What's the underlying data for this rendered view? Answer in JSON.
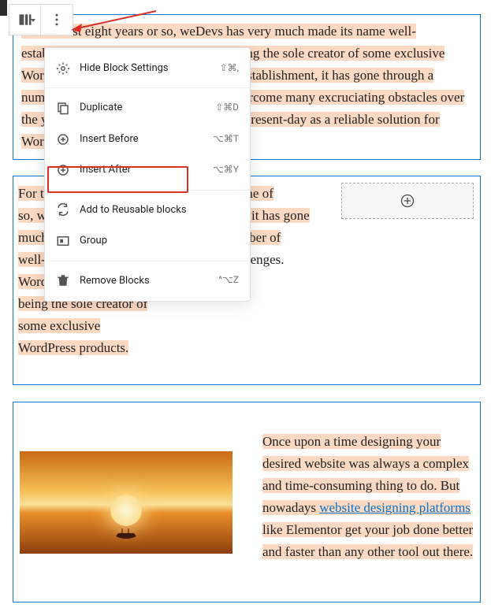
{
  "toolbar": {
    "layout_button": "change-layout",
    "more_button": "more-options"
  },
  "menu": {
    "hide_settings": {
      "label": "Hide Block Settings",
      "shortcut": "⇧⌘,"
    },
    "duplicate": {
      "label": "Duplicate",
      "shortcut": "⇧⌘D"
    },
    "insert_before": {
      "label": "Insert Before",
      "shortcut": "⌥⌘T"
    },
    "insert_after": {
      "label": "Insert After",
      "shortcut": "⌥⌘Y"
    },
    "add_reusable": {
      "label": "Add to Reusable blocks",
      "shortcut": ""
    },
    "group": {
      "label": "Group",
      "shortcut": ""
    },
    "remove": {
      "label": "Remove Blocks",
      "shortcut": "^⌥Z"
    }
  },
  "blocks": {
    "p1": "For the last eight years or so, weDevs has very much made its name well-established in the WordPress arena for being the sole creator of some exclusive WordPress products. During this time of establishment, it has gone through a number of unknown challenges. It has overcome many excruciating obstacles over the years to make its journey this far into present-day as a reliable solution for WordPress users.",
    "p2a": "For the last eight years or so, weDevs has very much made its name well-established in the WordPress arena for being the sole creator of some exclusive WordPress products.",
    "p2b_before": "During this time of establishment, it has gone through a number of unknown",
    "p2b_after": "challenges.",
    "p3_before": "Once upon a time designing your desired website was always a complex and time-consuming thing to do. But nowadays ",
    "p3_link": "website designing platforms",
    "p3_after": " like Elementor get your job done better and faster than any other tool out there."
  },
  "colors": {
    "highlight": "#fbd9c3",
    "selection_border": "#0a73cc",
    "callout": "#d93025"
  }
}
